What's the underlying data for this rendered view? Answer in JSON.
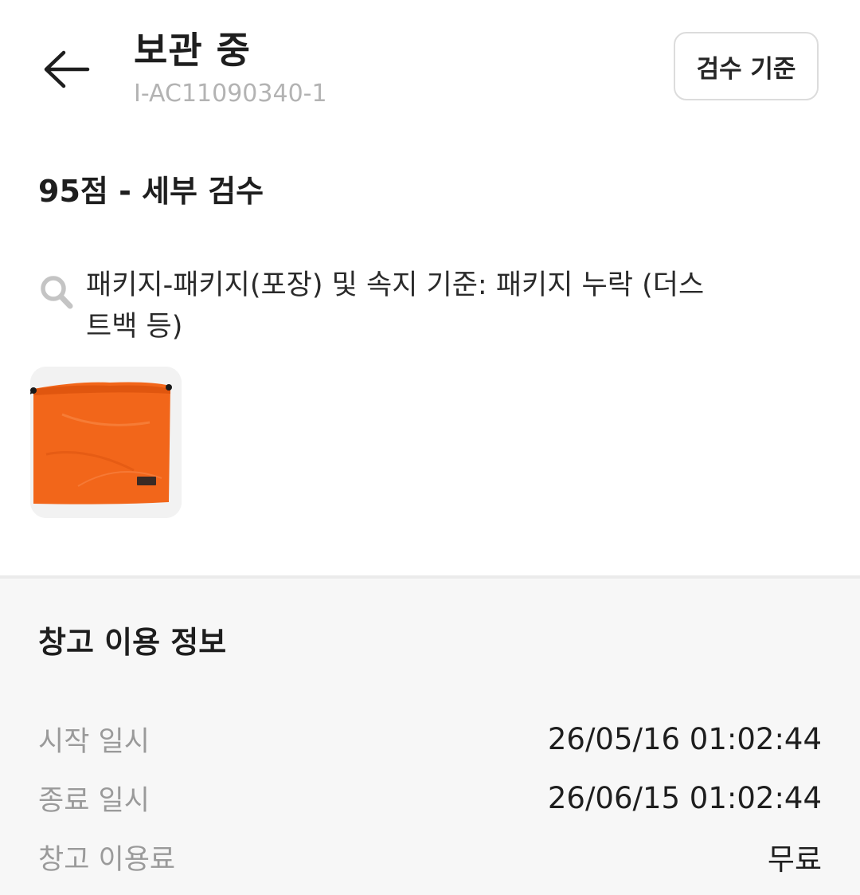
{
  "header": {
    "back_icon": "arrow-left-icon",
    "title": "보관 중",
    "code": "I-AC11090340-1",
    "criteria_button": "검수 기준"
  },
  "inspection": {
    "score": "95점 - 세부 검수",
    "note_icon": "search-icon",
    "note": "패키지-패키지(포장) 및 속지 기준: 패키지 누락 (더스트백 등)"
  },
  "storage": {
    "title": "창고 이용 정보",
    "rows": [
      {
        "label": "시작 일시",
        "value": "26/05/16 01:02:44"
      },
      {
        "label": "종료 일시",
        "value": "26/06/15 01:02:44"
      },
      {
        "label": "창고 이용료",
        "value": "무료"
      }
    ]
  },
  "colors": {
    "bag_orange": "#f2661a",
    "panel_bg": "#f7f7f7",
    "muted_text": "#9a9a9a"
  }
}
